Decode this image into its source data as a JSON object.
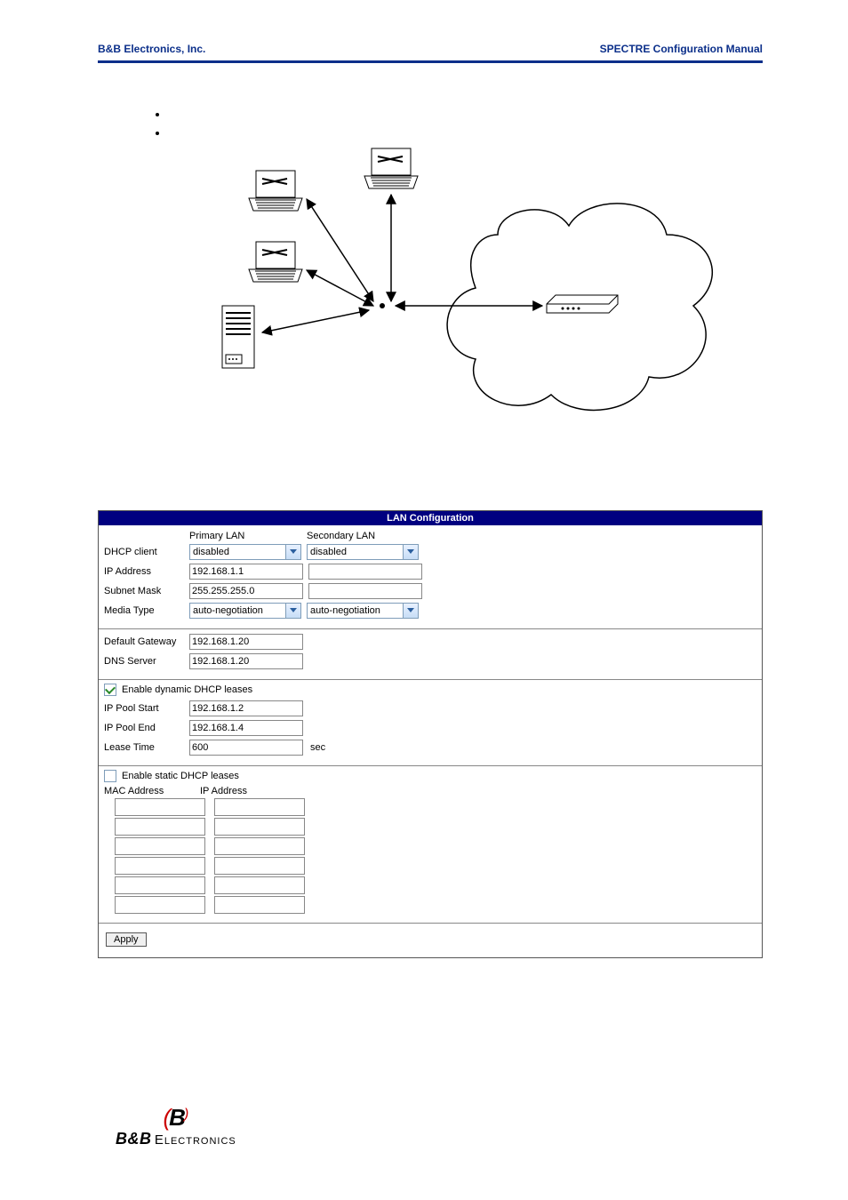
{
  "header": {
    "left": "B&B Electronics, Inc.",
    "right": "SPECTRE Configuration Manual"
  },
  "bullets": [
    "",
    ""
  ],
  "panel": {
    "title": "LAN Configuration",
    "col_primary": "Primary LAN",
    "col_secondary": "Secondary LAN",
    "rows": {
      "dhcp_client": {
        "label": "DHCP client",
        "primary": "disabled",
        "secondary": "disabled"
      },
      "ip_address": {
        "label": "IP Address",
        "primary": "192.168.1.1",
        "secondary": ""
      },
      "subnet": {
        "label": "Subnet Mask",
        "primary": "255.255.255.0",
        "secondary": ""
      },
      "media_type": {
        "label": "Media Type",
        "primary": "auto-negotiation",
        "secondary": "auto-negotiation"
      }
    },
    "gateway": {
      "label": "Default Gateway",
      "value": "192.168.1.20"
    },
    "dns": {
      "label": "DNS Server",
      "value": "192.168.1.20"
    },
    "dyn_check": "Enable dynamic DHCP leases",
    "pool_start": {
      "label": "IP Pool Start",
      "value": "192.168.1.2"
    },
    "pool_end": {
      "label": "IP Pool End",
      "value": "192.168.1.4"
    },
    "lease": {
      "label": "Lease Time",
      "value": "600",
      "unit": "sec"
    },
    "static_check": "Enable static DHCP leases",
    "static_head_mac": "MAC Address",
    "static_head_ip": "IP Address",
    "apply": "Apply"
  },
  "footer": {
    "line1": "B&B",
    "line2": "Electronics"
  }
}
